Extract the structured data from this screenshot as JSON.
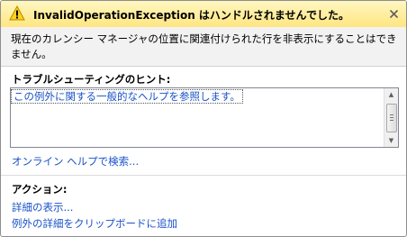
{
  "window": {
    "title": "InvalidOperationException はハンドルされませんでした。",
    "icons": {
      "warning": "warning-triangle-icon",
      "close": "close-x-icon"
    }
  },
  "message": "現在のカレンシー マネージャの位置に関連付けられた行を非表示にすることはできません。",
  "hints": {
    "heading": "トラブルシューティングのヒント:",
    "items": [
      "この例外に関する一般的なヘルプを参照します。"
    ]
  },
  "online_help_link": "オンライン ヘルプで検索...",
  "actions": {
    "heading": "アクション:",
    "items": [
      "詳細の表示...",
      "例外の詳細をクリップボードに追加"
    ]
  },
  "colors": {
    "titlebar_top": "#fff7c2",
    "titlebar_bottom": "#ffe680",
    "link": "#1a52c8",
    "message_bg": "#f2f2f2"
  }
}
